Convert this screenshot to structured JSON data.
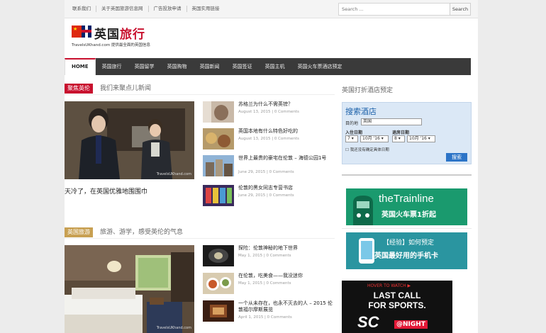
{
  "topbar": {
    "links": [
      "联系我们",
      "关于英国旅游信息网",
      "广告投放申请",
      "英国实用链接"
    ],
    "search_placeholder": "Search ...",
    "search_button": "Search"
  },
  "logo": {
    "title_black": "英国",
    "title_red": "旅行",
    "subtitle": "TravelsUKhand.com  提供最全面的英国信息"
  },
  "nav": {
    "items": [
      "HOME",
      "英国旅行",
      "英国留学",
      "英国购物",
      "英国新闻",
      "英国签证",
      "英国主机",
      "英国火车票酒店预定"
    ]
  },
  "section1": {
    "label": "聚焦英伦",
    "desc": "我们来聚点儿新闻",
    "feature_caption": "天冷了，在英国优雅地围围巾",
    "watermark": "TravelsUKhand.com",
    "items": [
      {
        "title": "苏格兰为什么不需英镑？",
        "meta": "August 13, 2015 | 0 Comments"
      },
      {
        "title": "英国本地有什么特色好吃的",
        "meta": "August 13, 2015 | 0 Comments"
      },
      {
        "title": "世界上最贵的豪宅在伦敦 – 海德公园1号",
        "meta": "June 29, 2015 | 0 Comments"
      },
      {
        "title": "伦敦的黑女同志专营书店",
        "meta": "June 29, 2015 | 0 Comments"
      }
    ]
  },
  "section2": {
    "label": "英国旅游",
    "desc": "旅游、游学，感受英伦的气息",
    "watermark": "TravelsUKhand.com",
    "items": [
      {
        "title": "探险：伦敦神秘的地下世界",
        "meta": "May 1, 2015 | 0 Comments"
      },
      {
        "title": "在伦敦，吃美食——我没迷你",
        "meta": "May 1, 2015 | 0 Comments"
      },
      {
        "title": "一个从未存在，也永不灭去的人 – 2015 伦敦福尔摩斯展览",
        "meta": "April 1, 2015 | 0 Comments"
      }
    ]
  },
  "sidebar": {
    "title": "英国打折酒店预定",
    "hotel": {
      "title": "搜索酒店",
      "dest_label": "目的地",
      "dest_value": "英国",
      "checkin_label": "入住日期",
      "checkout_label": "退房日期",
      "checkin_day": "7",
      "checkin_month": "10月 '16",
      "checkout_day": "8",
      "checkout_month": "10月 '16",
      "nodate": "我还没有确定具体日期",
      "button": "搜索"
    },
    "banner1": {
      "brand": "theTrainline",
      "text": "英国火车票1折起"
    },
    "banner2": {
      "tag": "【经验】如何预定",
      "text": "英国最好用的手机卡"
    },
    "ad": {
      "top": "HOVER TO WATCH ▶",
      "line1": "LAST CALL",
      "line2": "FOR SPORTS.",
      "logo": "SC",
      "night": "@NIGHT"
    }
  },
  "colors": {
    "accent_red": "#c8102e",
    "section_gold": "#c8a052",
    "nav_bg": "#3a3a3a",
    "trainline_green": "#1a9a6e",
    "banner_teal": "#2a95a0"
  }
}
